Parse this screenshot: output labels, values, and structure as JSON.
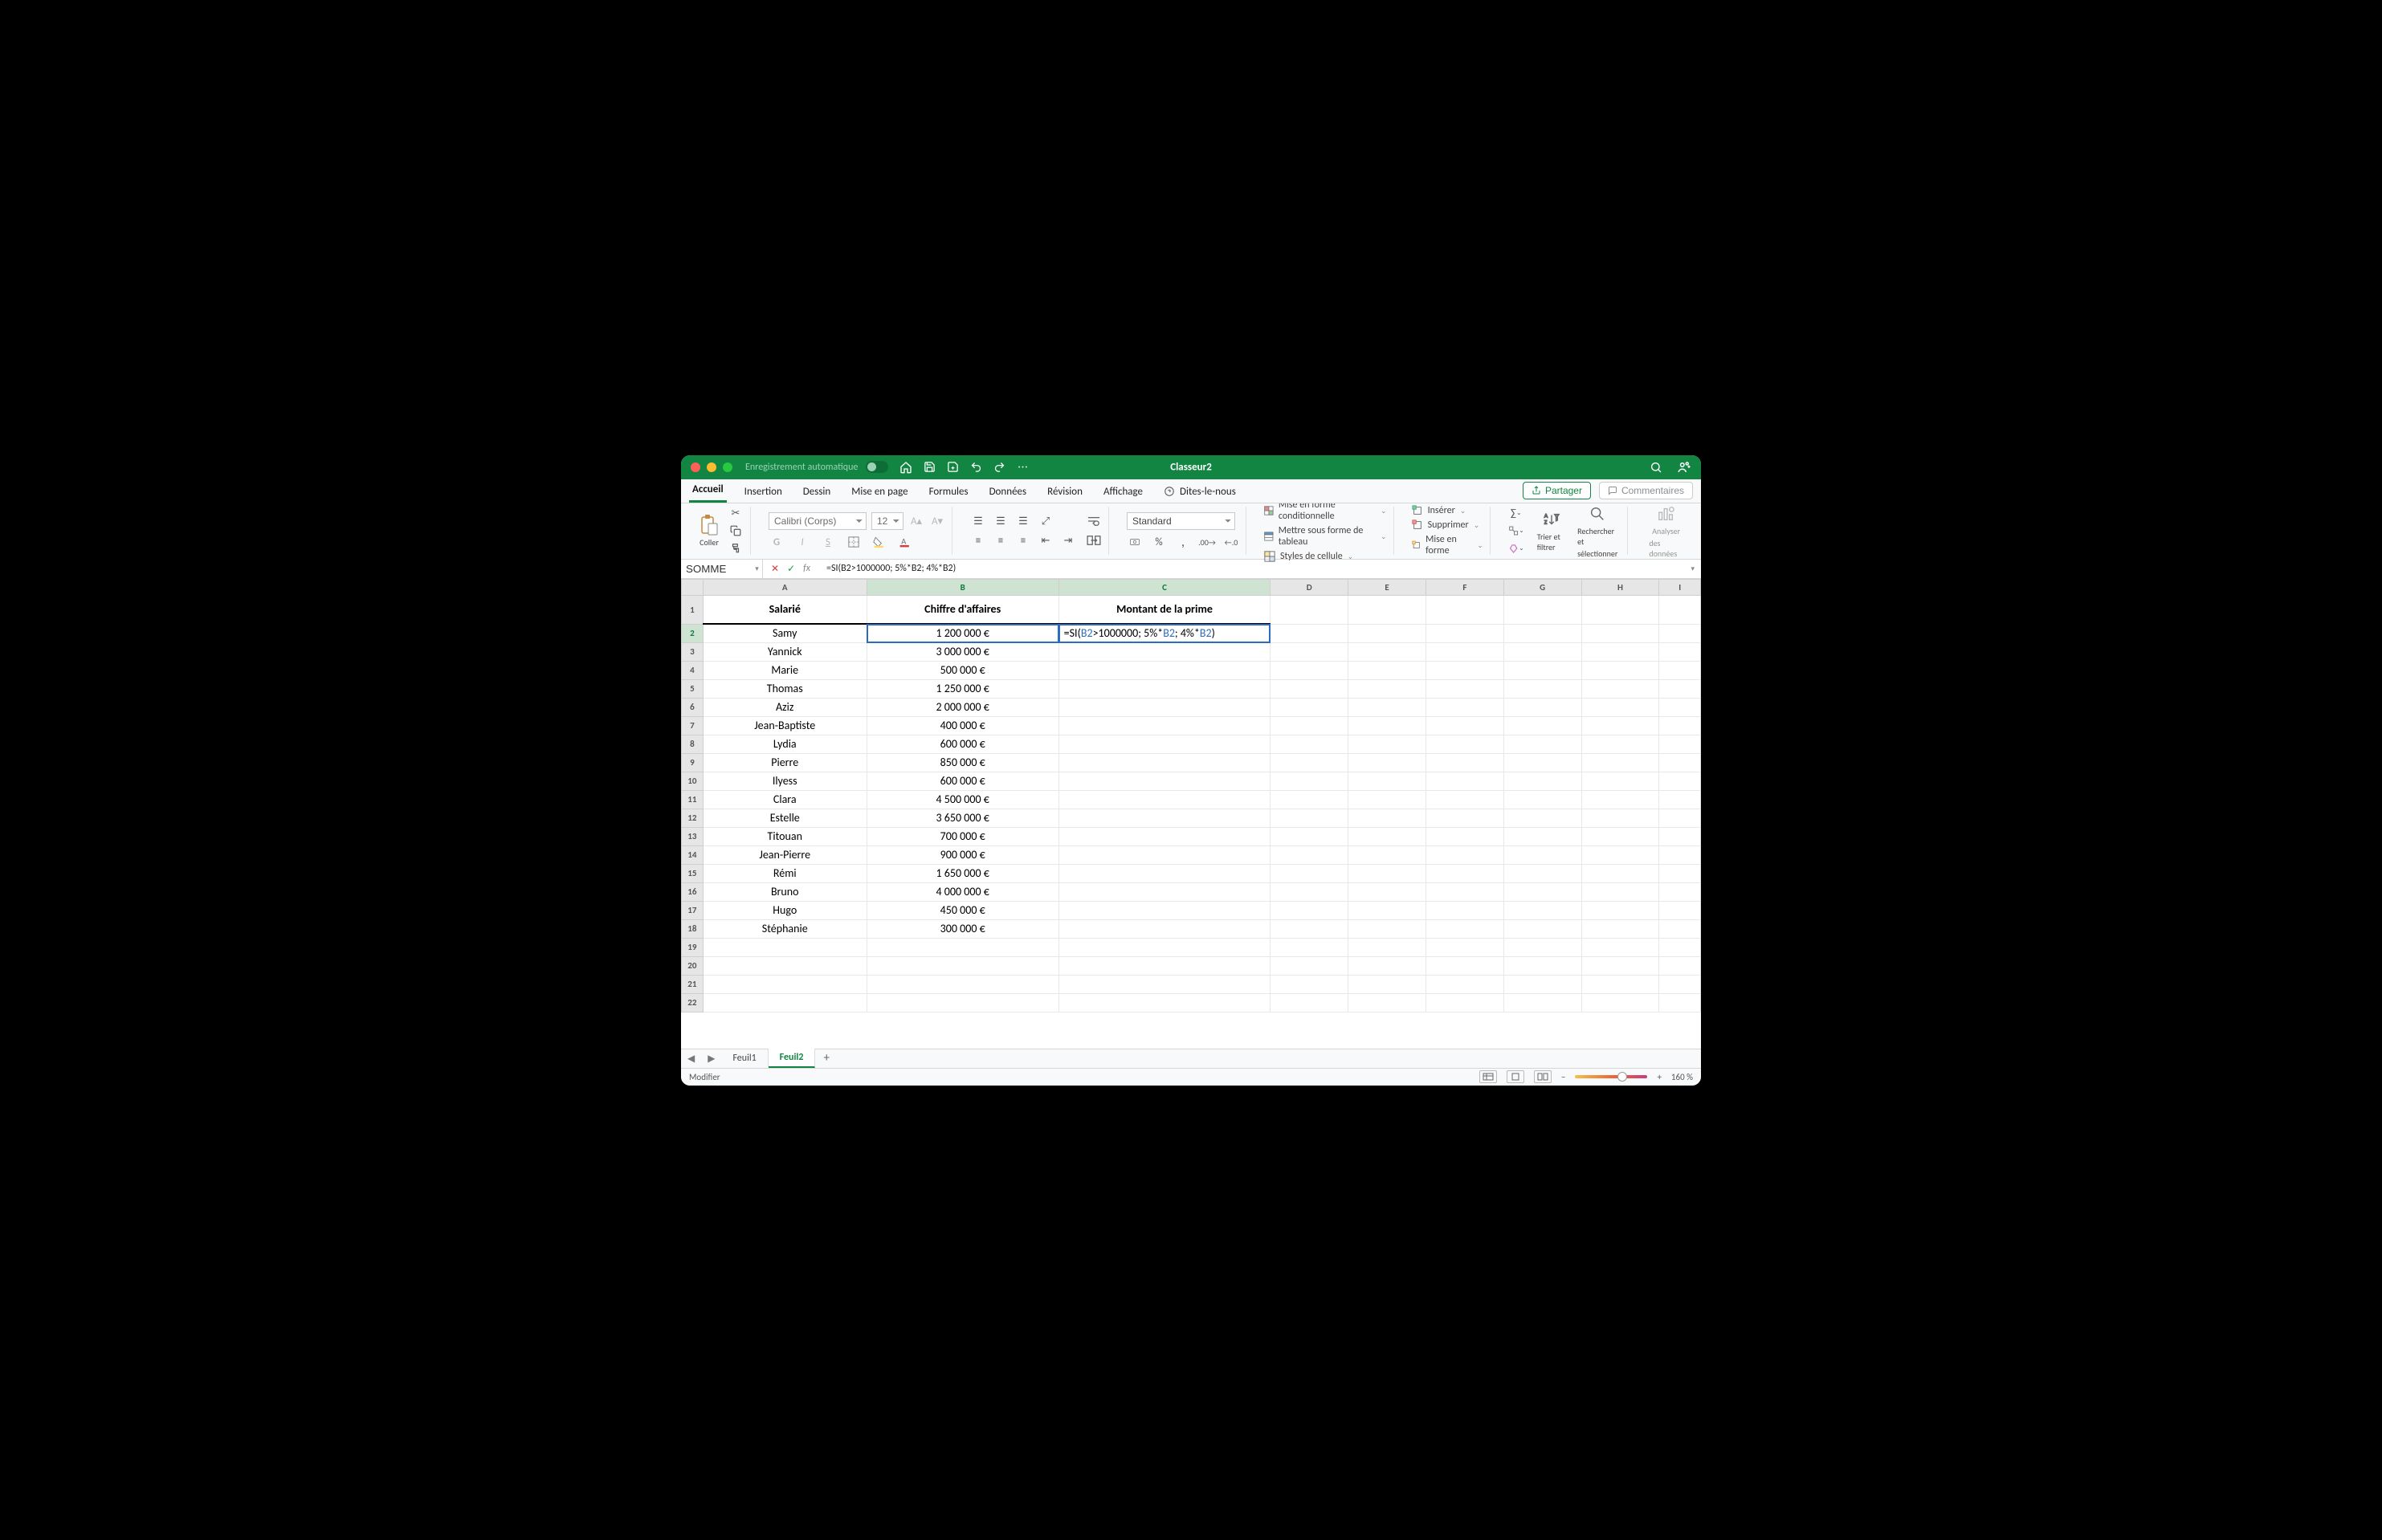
{
  "window": {
    "title": "Classeur2"
  },
  "titlebar": {
    "autosave_label": "Enregistrement automatique"
  },
  "tabs": {
    "items": [
      "Accueil",
      "Insertion",
      "Dessin",
      "Mise en page",
      "Formules",
      "Données",
      "Révision",
      "Affichage"
    ],
    "tell_me": "Dites-le-nous",
    "share": "Partager",
    "comments": "Commentaires"
  },
  "ribbon": {
    "paste": "Coller",
    "font_name": "Calibri (Corps)",
    "font_size": "12",
    "number_format": "Standard",
    "cond_fmt": "Mise en forme conditionnelle",
    "as_table": "Mettre sous forme de tableau",
    "cell_styles": "Styles de cellule",
    "insert": "Insérer",
    "delete": "Supprimer",
    "format": "Mise en forme",
    "sort_filter": "Trier et filtrer",
    "find_select_line1": "Rechercher et",
    "find_select_line2": "sélectionner",
    "analyze_line1": "Analyser",
    "analyze_line2": "des données"
  },
  "formula_bar": {
    "name_box": "SOMME",
    "formula": "=SI(B2>1000000; 5%*B2; 4%*B2)"
  },
  "columns": [
    "A",
    "B",
    "C",
    "D",
    "E",
    "F",
    "G",
    "H",
    "I"
  ],
  "col_widths": [
    "198",
    "232",
    "256",
    "94",
    "94",
    "94",
    "94",
    "94",
    "50"
  ],
  "headers": {
    "A": "Salarié",
    "B": "Chiffre d'affaires",
    "C": "Montant de la prime"
  },
  "rows": [
    {
      "n": "1"
    },
    {
      "n": "2",
      "A": "Samy",
      "B": "1 200 000 €"
    },
    {
      "n": "3",
      "A": "Yannick",
      "B": "3 000 000 €"
    },
    {
      "n": "4",
      "A": "Marie",
      "B": "500 000 €"
    },
    {
      "n": "5",
      "A": "Thomas",
      "B": "1 250 000 €"
    },
    {
      "n": "6",
      "A": "Aziz",
      "B": "2 000 000 €"
    },
    {
      "n": "7",
      "A": "Jean-Baptiste",
      "B": "400 000 €"
    },
    {
      "n": "8",
      "A": "Lydia",
      "B": "600 000 €"
    },
    {
      "n": "9",
      "A": "Pierre",
      "B": "850 000 €"
    },
    {
      "n": "10",
      "A": "Ilyess",
      "B": "600 000 €"
    },
    {
      "n": "11",
      "A": "Clara",
      "B": "4 500 000 €"
    },
    {
      "n": "12",
      "A": "Estelle",
      "B": "3 650 000 €"
    },
    {
      "n": "13",
      "A": "Titouan",
      "B": "700 000 €"
    },
    {
      "n": "14",
      "A": "Jean-Pierre",
      "B": "900 000 €"
    },
    {
      "n": "15",
      "A": "Rémi",
      "B": "1 650 000 €"
    },
    {
      "n": "16",
      "A": "Bruno",
      "B": "4 000 000 €"
    },
    {
      "n": "17",
      "A": "Hugo",
      "B": "450 000 €"
    },
    {
      "n": "18",
      "A": "Stéphanie",
      "B": "300 000 €"
    },
    {
      "n": "19"
    },
    {
      "n": "20"
    },
    {
      "n": "21"
    },
    {
      "n": "22"
    }
  ],
  "editing_cell_formula": {
    "prefix": "=SI(",
    "ref1": "B2",
    "mid1": ">1000000; 5%*",
    "ref2": "B2",
    "mid2": "; 4%*",
    "ref3": "B2",
    "suffix": ")"
  },
  "sheet_tabs": {
    "items": [
      "Feuil1",
      "Feuil2"
    ],
    "active_index": 1
  },
  "statusbar": {
    "mode": "Modifier",
    "zoom": "160 %"
  }
}
